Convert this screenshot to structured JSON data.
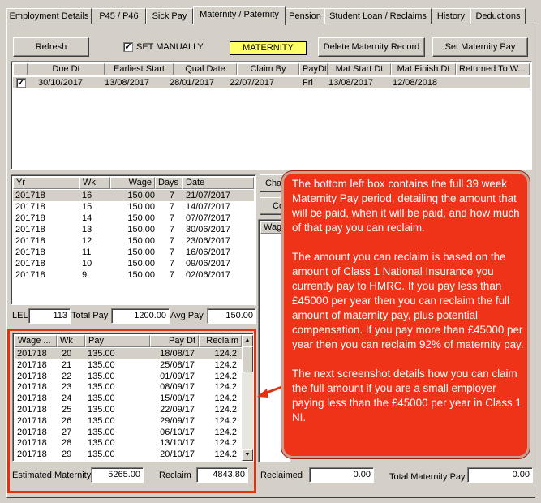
{
  "tabs": [
    {
      "label": "Employment Details"
    },
    {
      "label": "P45 / P46"
    },
    {
      "label": "Sick Pay"
    },
    {
      "label": "Maternity / Paternity",
      "active": true
    },
    {
      "label": "Pension"
    },
    {
      "label": "Student Loan / Reclaims"
    },
    {
      "label": "History"
    },
    {
      "label": "Deductions"
    }
  ],
  "toolbar": {
    "refresh_label": "Refresh",
    "set_manually_label": "SET MANUALLY",
    "set_manually_checked": "✓",
    "maternity_badge": "MATERNITY",
    "delete_label": "Delete Maternity Record",
    "set_pay_label": "Set Maternity Pay"
  },
  "records": {
    "columns": [
      "",
      "Due Dt",
      "Earliest Start",
      "Qual Date",
      "Claim By",
      "PayDt",
      "Mat Start Dt",
      "Mat Finish Dt",
      "Returned To W..."
    ],
    "rows": [
      {
        "check": "✓",
        "due": "30/10/2017",
        "earliest": "13/08/2017",
        "qual": "28/01/2017",
        "claim": "22/07/2017",
        "paydt": "Fri",
        "start": "13/08/2017",
        "finish": "12/08/2018",
        "returned": ""
      }
    ]
  },
  "earnings": {
    "columns": [
      "Yr",
      "Wk",
      "Wage",
      "Days",
      "Date"
    ],
    "rows": [
      {
        "yr": "201718",
        "wk": "16",
        "wage": "150.00",
        "days": "7",
        "date": "21/07/2017"
      },
      {
        "yr": "201718",
        "wk": "15",
        "wage": "150.00",
        "days": "7",
        "date": "14/07/2017"
      },
      {
        "yr": "201718",
        "wk": "14",
        "wage": "150.00",
        "days": "7",
        "date": "07/07/2017"
      },
      {
        "yr": "201718",
        "wk": "13",
        "wage": "150.00",
        "days": "7",
        "date": "30/06/2017"
      },
      {
        "yr": "201718",
        "wk": "12",
        "wage": "150.00",
        "days": "7",
        "date": "23/06/2017"
      },
      {
        "yr": "201718",
        "wk": "11",
        "wage": "150.00",
        "days": "7",
        "date": "16/06/2017"
      },
      {
        "yr": "201718",
        "wk": "10",
        "wage": "150.00",
        "days": "7",
        "date": "09/06/2017"
      },
      {
        "yr": "201718",
        "wk": "9",
        "wage": "150.00",
        "days": "7",
        "date": "02/06/2017"
      }
    ]
  },
  "summary": {
    "lel_label": "LEL",
    "lel_value": "113",
    "total_pay_label": "Total Pay",
    "total_pay_value": "1200.00",
    "avg_pay_label": "Avg Pay",
    "avg_pay_value": "150.00"
  },
  "side": {
    "btn1_label": "Cha",
    "btn2_label": "Co",
    "col_label": "Wag"
  },
  "payments": {
    "columns": [
      "Wage ...",
      "Wk",
      "Pay",
      "Pay Dt",
      "Reclaim"
    ],
    "rows": [
      {
        "yr": "201718",
        "wk": "20",
        "pay": "135.00",
        "paydt": "18/08/17",
        "reclaim": "124.2"
      },
      {
        "yr": "201718",
        "wk": "21",
        "pay": "135.00",
        "paydt": "25/08/17",
        "reclaim": "124.2"
      },
      {
        "yr": "201718",
        "wk": "22",
        "pay": "135.00",
        "paydt": "01/09/17",
        "reclaim": "124.2"
      },
      {
        "yr": "201718",
        "wk": "23",
        "pay": "135.00",
        "paydt": "08/09/17",
        "reclaim": "124.2"
      },
      {
        "yr": "201718",
        "wk": "24",
        "pay": "135.00",
        "paydt": "15/09/17",
        "reclaim": "124.2"
      },
      {
        "yr": "201718",
        "wk": "25",
        "pay": "135.00",
        "paydt": "22/09/17",
        "reclaim": "124.2"
      },
      {
        "yr": "201718",
        "wk": "26",
        "pay": "135.00",
        "paydt": "29/09/17",
        "reclaim": "124.2"
      },
      {
        "yr": "201718",
        "wk": "27",
        "pay": "135.00",
        "paydt": "06/10/17",
        "reclaim": "124.2"
      },
      {
        "yr": "201718",
        "wk": "28",
        "pay": "135.00",
        "paydt": "13/10/17",
        "reclaim": "124.2"
      },
      {
        "yr": "201718",
        "wk": "29",
        "pay": "135.00",
        "paydt": "20/10/17",
        "reclaim": "124.2"
      }
    ]
  },
  "footer": {
    "estimated_label": "Estimated Maternity",
    "estimated_value": "5265.00",
    "reclaim_label": "Reclaim",
    "reclaim_value": "4843.80",
    "reclaimed_label": "Reclaimed",
    "reclaimed_value": "0.00",
    "total_label": "Total Maternity Pay",
    "total_value": "0.00"
  },
  "callout": {
    "paragraphs": [
      "The bottom left box contains the full 39 week Maternity Pay period, detailing the amount that will be paid, when it will be paid, and how much of that pay you can reclaim.",
      "The amount you can reclaim is based on the amount of Class 1 National Insurance you currently pay to HMRC. If you pay less than £45000 per year then you can reclaim the full amount of maternity pay, plus potential compensation. If you pay more than £45000 per year then you can reclaim 92% of maternity pay.",
      "The next screenshot details how you can claim the full amount if you are a small employer paying less than the £45000 per year in Class 1 NI."
    ]
  },
  "colors": {
    "annotation_red": "#e3300f",
    "callout_fill": "#ee3318",
    "badge_yellow": "#ffff66",
    "window_gray": "#d4d0c8"
  }
}
